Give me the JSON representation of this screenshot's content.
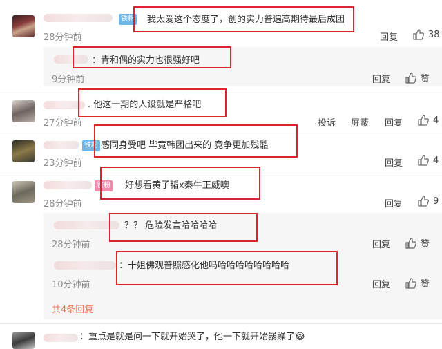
{
  "comments": [
    {
      "text": "我太爱这个态度了，创的实力普遍高期待最后成团",
      "time": "28分钟前",
      "reply": "回复",
      "likes": "38",
      "badge": "铁粉"
    },
    {
      "text": "：青和偶的实力也很强好吧",
      "time": "9分钟前",
      "reply": "回复",
      "likes": "赞"
    },
    {
      "text": ". 他这一期的人设就是严格吧",
      "time": "27分钟前",
      "report": "投诉",
      "block": "屏蔽",
      "reply": "回复",
      "likes": "4"
    },
    {
      "text": "感同身受吧 毕竟韩团出来的 竞争更加残酷",
      "time": "23分钟前",
      "reply": "回复",
      "likes": "4",
      "badge": "铁粉"
    },
    {
      "text": "好想看黄子韬x秦牛正威噢",
      "time": "28分钟前",
      "reply": "回复",
      "likes": "9",
      "badge": "铁粉"
    },
    {
      "text": "？？ 危险发言哈哈哈哈",
      "time": "28分钟前",
      "reply": "回复",
      "likes": "赞"
    },
    {
      "text": "：十姐佛观普照感化他吗哈哈哈哈哈哈哈哈",
      "time": "10分钟前",
      "reply": "回复",
      "likes": "赞"
    },
    {
      "text": "：重点是就是问一下就开始哭了，他一下就开始暴躁了",
      "emoji": "😂"
    }
  ],
  "more_replies": "共4条回复",
  "colors": {
    "highlight": "#d9262c",
    "link": "#eb7350",
    "badge_blue": "#6fb5e8",
    "badge_pink": "#f08cb0"
  }
}
